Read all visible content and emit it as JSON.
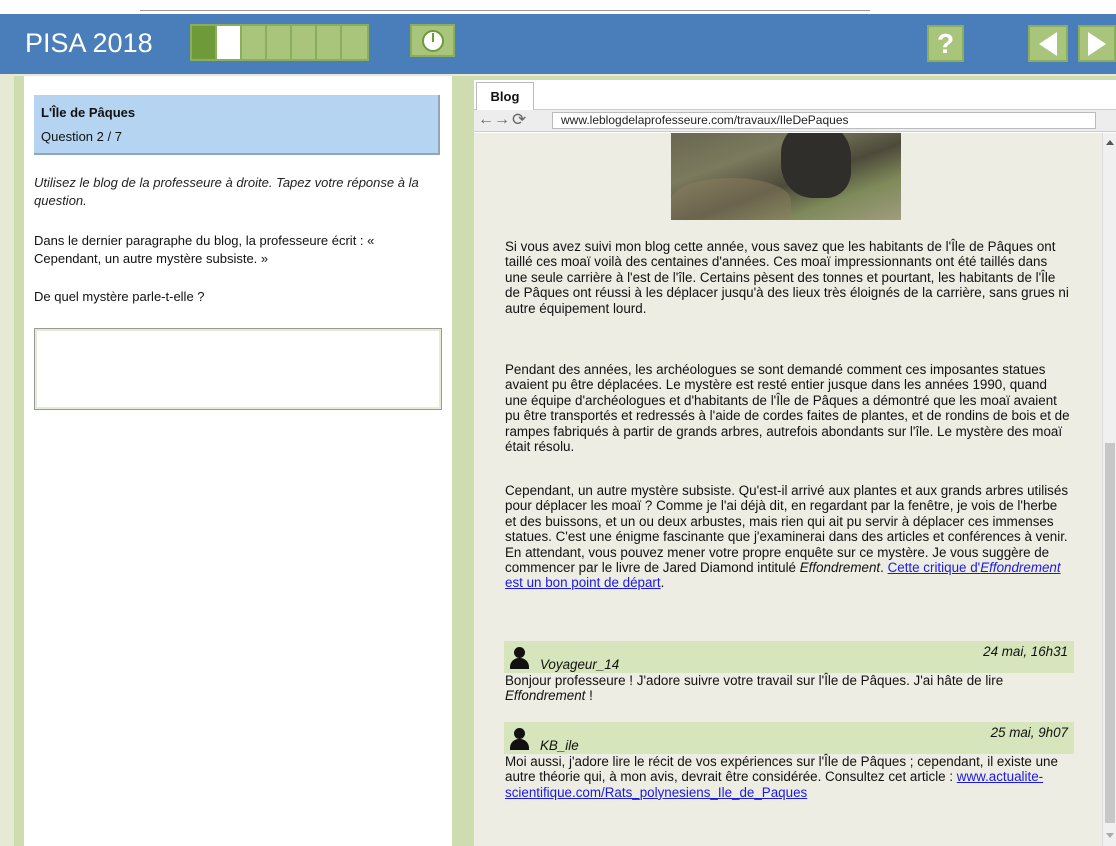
{
  "header": {
    "app_title": "PISA 2018",
    "progress": {
      "total": 7,
      "done": 1,
      "current": 2
    },
    "help_label": "?"
  },
  "question": {
    "title": "L'Île de Pâques",
    "number": "Question 2 / 7",
    "instruction": "Utilisez le blog de la professeure à droite. Tapez votre réponse à la question.",
    "prompt_1": "Dans le dernier paragraphe du blog, la professeure écrit : « Cependant, un autre mystère subsiste. »",
    "prompt_2": "De quel mystère parle-t-elle ?",
    "answer_value": ""
  },
  "browser": {
    "tab_label": "Blog",
    "url": "www.leblogdelaprofesseure.com/travaux/IleDePaques"
  },
  "blog": {
    "para_1": "Si vous avez suivi mon blog cette année, vous savez que les habitants de l'Île de Pâques ont taillé ces moaï voilà des centaines d'années. Ces moaï impressionnants ont été taillés dans une seule carrière à l'est de l'île. Certains pèsent des tonnes et pourtant, les habitants de l'Île de Pâques ont réussi à les déplacer jusqu'à des lieux très éloignés de la carrière, sans grues ni autre équipement lourd.",
    "para_2": "Pendant des années, les archéologues se sont demandé comment ces imposantes statues avaient pu être déplacées. Le mystère est resté entier jusque dans les années 1990, quand une équipe d'archéologues et d'habitants de l'Île de Pâques a démontré que les moaï avaient pu être transportés et redressés à l'aide de cordes faites de plantes, et de rondins de bois et de rampes fabriqués à partir de grands arbres, autrefois abondants sur l'île. Le mystère des moaï était résolu.",
    "para_3_text": "Cependant, un autre mystère subsiste. Qu'est-il arrivé aux plantes et aux grands arbres utilisés pour déplacer les moaï ? Comme je l'ai déjà dit, en regardant par la fenêtre, je vois de l'herbe et des buissons, et un ou deux arbustes, mais rien qui ait pu servir à déplacer ces immenses statues. C'est une énigme fascinante que j'examinerai dans des articles et conférences à venir. En attendant, vous pouvez mener votre propre enquête sur ce mystère. Je vous suggère de commencer par le livre de Jared Diamond intitulé ",
    "book_title": "Effondrement",
    "para_3_after_book": ". ",
    "link_before": "Cette critique d'",
    "link_book": "Effondrement",
    "link_after": " est un bon point de départ",
    "para_3_end": "."
  },
  "comments": [
    {
      "date": "24 mai, 16h31",
      "user": "Voyageur_14",
      "text_before": "Bonjour professeure ! J'adore suivre votre travail sur l'Île de Pâques. J'ai hâte de lire ",
      "book": "Effondrement",
      "text_after": " !"
    },
    {
      "date": "25 mai, 9h07",
      "user": "KB_ile",
      "text": "Moi aussi, j'adore lire le récit de vos expériences sur l'Île de Pâques ; cependant, il existe une autre théorie qui, à mon avis, devrait être considérée. Consultez cet article : ",
      "link": "www.actualite-scientifique.com/Rats_polynesiens_Ile_de_Paques"
    }
  ],
  "colors": {
    "header_bg": "#4a7ebb",
    "progress_done": "#6e9a3a",
    "progress_todo": "#a9c57c",
    "panel_bg": "#cfdcaf",
    "question_card": "#b5d4f1",
    "blog_bg": "#edede3",
    "comment_head": "#d6e5bb",
    "link": "#1a1ae6"
  },
  "icons": {
    "timer": "clock-icon",
    "help": "help-icon",
    "prev": "arrow-left-icon",
    "next": "arrow-right-icon",
    "back": "back-arrow-icon",
    "forward": "forward-arrow-icon",
    "reload": "reload-icon",
    "avatar": "user-icon"
  }
}
